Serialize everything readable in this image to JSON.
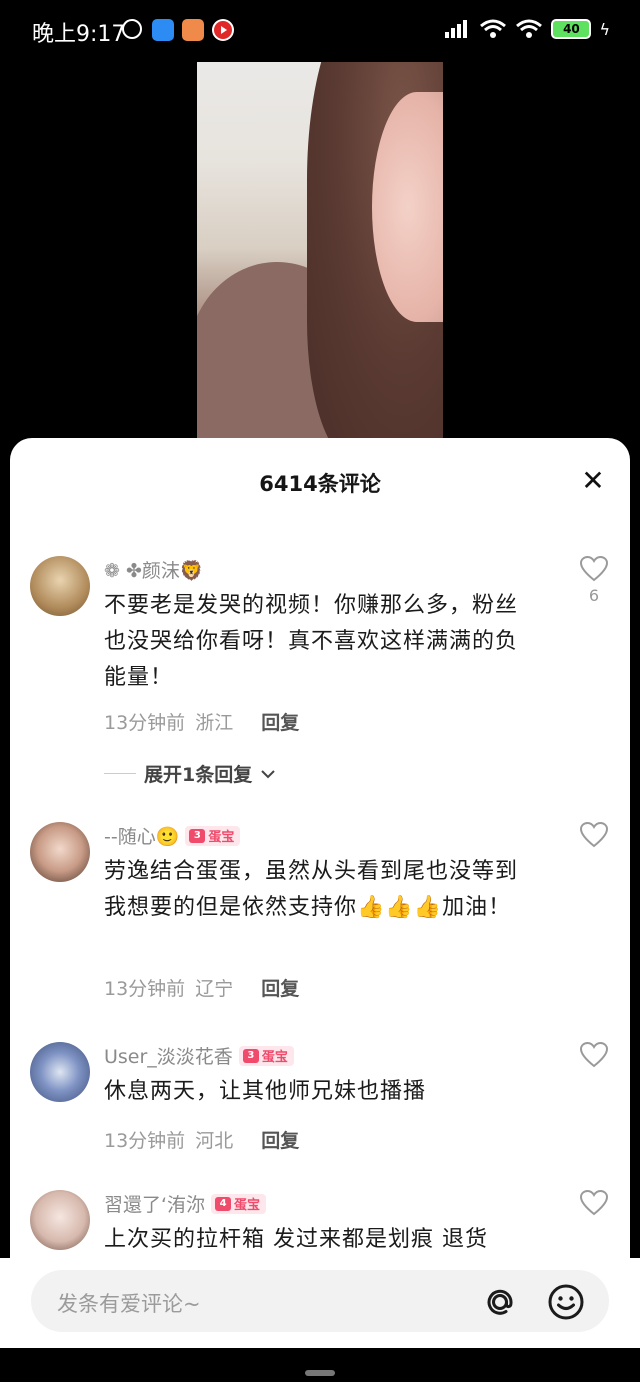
{
  "status_bar": {
    "time": "晚上9:17",
    "battery": "40"
  },
  "sheet": {
    "title": "6414条评论"
  },
  "comments": [
    {
      "username": "❁ ✤颜沫🦁",
      "text": "不要老是发哭的视频！你赚那么多，粉丝也没哭给你看呀！真不喜欢这样满满的负能量！",
      "time": "13分钟前",
      "location": "浙江",
      "reply_label": "回复",
      "like_count": "6",
      "expand_label": "展开1条回复"
    },
    {
      "username": "--随心🙂",
      "badge": "蛋宝",
      "badge_level": "3",
      "text": "劳逸结合蛋蛋，虽然从头看到尾也没等到我想要的但是依然支持你👍👍👍加油！",
      "time": "13分钟前",
      "location": "辽宁",
      "reply_label": "回复"
    },
    {
      "username": "User_淡淡花香",
      "badge": "蛋宝",
      "badge_level": "3",
      "text": "休息两天，让其他师兄妹也播播",
      "time": "13分钟前",
      "location": "河北",
      "reply_label": "回复"
    },
    {
      "username": "習還了‘洧沵",
      "badge": "蛋宝",
      "badge_level": "4",
      "text": "上次买的拉杆箱  发过来都是划痕 退货"
    }
  ],
  "input": {
    "placeholder": "发条有爱评论~"
  },
  "colors": {
    "badge_bg": "#fde7ec",
    "badge_fg": "#f04b6b"
  }
}
